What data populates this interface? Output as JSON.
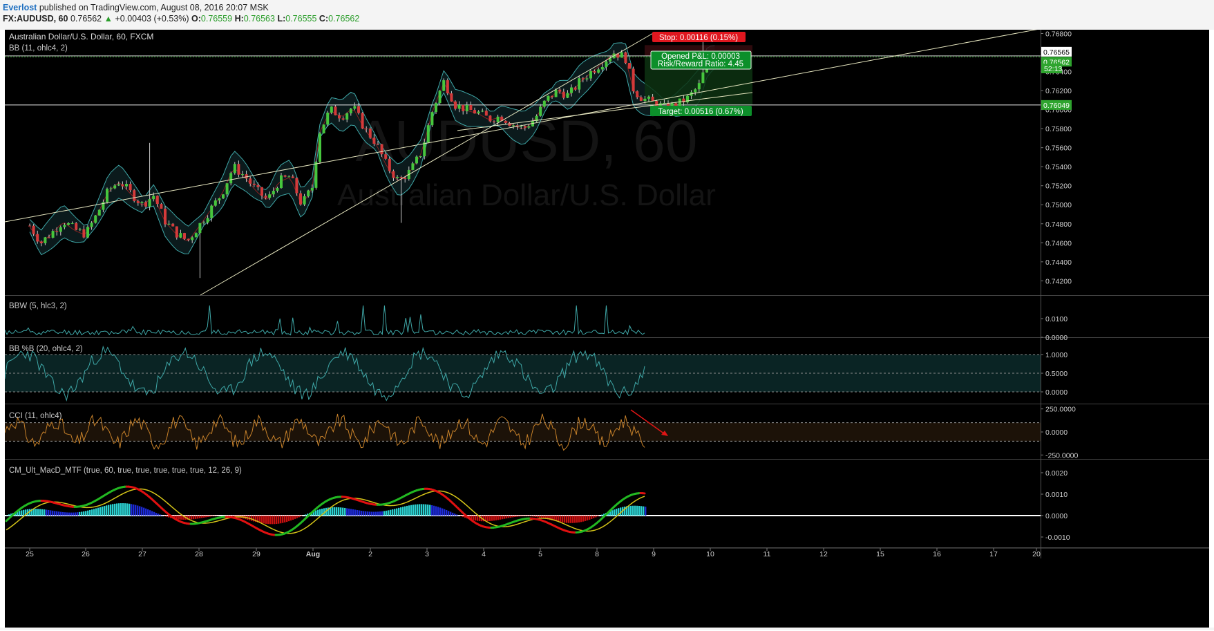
{
  "header": {
    "author": "Everlost",
    "published": "published on TradingView.com, August 08, 2016 20:07 MSK",
    "symbol": "FX:AUDUSD, 60",
    "last": "0.76562",
    "arrow": "▲",
    "change": "+0.00403 (+0.53%)",
    "o_label": "O:",
    "o_val": "0.76559",
    "h_label": "H:",
    "h_val": "0.76563",
    "l_label": "L:",
    "l_val": "0.76555",
    "c_label": "C:",
    "c_val": "0.76562"
  },
  "colors": {
    "background": "#000000",
    "bull_candle": "#46c63d",
    "bear_candle": "#d43a3a",
    "bollinger": "#3fa8a8",
    "trendline": "#e7e7c0",
    "stop": "#e0171f",
    "target": "#0c8f2a",
    "cci": "#c8822a",
    "macd_up": "#22b822",
    "macd_down": "#e01010",
    "signal": "#d4c418"
  },
  "chart_data": [
    {
      "type": "candlestick",
      "title": "Australian Dollar/U.S. Dollar, 60, FXCM",
      "indicator": "BB (11, ohlc4, 2)",
      "watermark_symbol": "AUDUSD, 60",
      "watermark_name": "Australian Dollar/U.S. Dollar",
      "x_ticks": [
        "25",
        "26",
        "27",
        "28",
        "29",
        "Aug",
        "2",
        "3",
        "4",
        "5",
        "8",
        "9",
        "10",
        "11",
        "12",
        "15",
        "16",
        "17",
        "20"
      ],
      "y_ticks": [
        "0.76800",
        "0.76600",
        "0.76400",
        "0.76200",
        "0.76000",
        "0.75800",
        "0.75600",
        "0.75400",
        "0.75200",
        "0.75000",
        "0.74800",
        "0.74600",
        "0.74400",
        "0.74200"
      ],
      "ylim": [
        0.7405,
        0.7684
      ],
      "price_tags": [
        {
          "label": "0.76565",
          "value": 0.76565
        },
        {
          "label": "0.76562",
          "value": 0.76562
        },
        {
          "label": "52:13",
          "value": 0.7645
        },
        {
          "label": "0.76049",
          "value": 0.76049
        }
      ],
      "position": {
        "stop": "Stop: 0.00116 (0.15%)",
        "pnl": "Opened P&L: 0.00003",
        "rr": "Risk/Reward Ratio: 4.45",
        "target": "Target: 0.00516 (0.67%)",
        "entry": 0.76562,
        "stop_level": 0.76678,
        "target_level": 0.76046
      },
      "close_path": [
        [
          25.0,
          0.7478
        ],
        [
          25.2,
          0.746
        ],
        [
          25.4,
          0.7471
        ],
        [
          25.6,
          0.7483
        ],
        [
          25.8,
          0.7474
        ],
        [
          26.0,
          0.7469
        ],
        [
          26.2,
          0.749
        ],
        [
          26.4,
          0.7515
        ],
        [
          26.6,
          0.7525
        ],
        [
          26.8,
          0.7512
        ],
        [
          27.0,
          0.75
        ],
        [
          27.2,
          0.751
        ],
        [
          27.4,
          0.7483
        ],
        [
          27.6,
          0.747
        ],
        [
          27.8,
          0.7462
        ],
        [
          28.0,
          0.7478
        ],
        [
          28.2,
          0.7495
        ],
        [
          28.4,
          0.7512
        ],
        [
          28.6,
          0.754
        ],
        [
          28.8,
          0.753
        ],
        [
          29.0,
          0.7515
        ],
        [
          29.2,
          0.7505
        ],
        [
          29.4,
          0.7525
        ],
        [
          29.6,
          0.753
        ],
        [
          29.8,
          0.75
        ],
        [
          30.0,
          0.752
        ],
        [
          30.1,
          0.7575
        ],
        [
          30.3,
          0.76
        ],
        [
          30.5,
          0.7593
        ],
        [
          30.7,
          0.7603
        ],
        [
          30.9,
          0.758
        ],
        [
          31.1,
          0.7565
        ],
        [
          31.3,
          0.754
        ],
        [
          31.5,
          0.7525
        ],
        [
          31.7,
          0.7535
        ],
        [
          31.9,
          0.7555
        ],
        [
          32.1,
          0.76
        ],
        [
          32.3,
          0.763
        ],
        [
          32.5,
          0.7605
        ],
        [
          32.7,
          0.76
        ],
        [
          32.9,
          0.7597
        ],
        [
          33.1,
          0.759
        ],
        [
          33.3,
          0.7593
        ],
        [
          33.5,
          0.7585
        ],
        [
          33.7,
          0.758
        ],
        [
          33.9,
          0.759
        ],
        [
          34.1,
          0.761
        ],
        [
          34.3,
          0.762
        ],
        [
          34.5,
          0.7615
        ],
        [
          34.7,
          0.763
        ],
        [
          34.9,
          0.764
        ],
        [
          35.1,
          0.765
        ],
        [
          35.3,
          0.766
        ],
        [
          35.5,
          0.7655
        ],
        [
          35.65,
          0.762
        ],
        [
          35.8,
          0.7612
        ],
        [
          36.0,
          0.7607
        ],
        [
          36.2,
          0.7602
        ],
        [
          36.4,
          0.7605
        ],
        [
          36.6,
          0.7612
        ],
        [
          36.8,
          0.7625
        ],
        [
          36.95,
          0.7651
        ],
        [
          37.1,
          0.76562
        ]
      ],
      "bands_halfwidth": 0.0012
    },
    {
      "type": "line",
      "title": "BBW (5, hlc3, 2)",
      "y_ticks": [
        "0.0100",
        "0.0000"
      ],
      "ylim": [
        0,
        0.02
      ]
    },
    {
      "type": "area",
      "title": "BB %B (20, ohlc4, 2)",
      "y_ticks": [
        "1.0000",
        "0.5000",
        "0.0000"
      ],
      "ylim": [
        -0.25,
        1.35
      ]
    },
    {
      "type": "line",
      "title": "CCI (11, ohlc4)",
      "y_ticks": [
        "250.0000",
        "0.0000",
        "-250.0000"
      ],
      "ylim": [
        -300,
        300
      ]
    },
    {
      "type": "bar",
      "title": "CM_Ult_MacD_MTF (true, 60, true, true, true, true, true, 12, 26, 9)",
      "y_ticks": [
        "0.0020",
        "0.0010",
        "0.0000",
        "-0.0010"
      ],
      "ylim": [
        -0.0014,
        0.0023
      ]
    }
  ]
}
